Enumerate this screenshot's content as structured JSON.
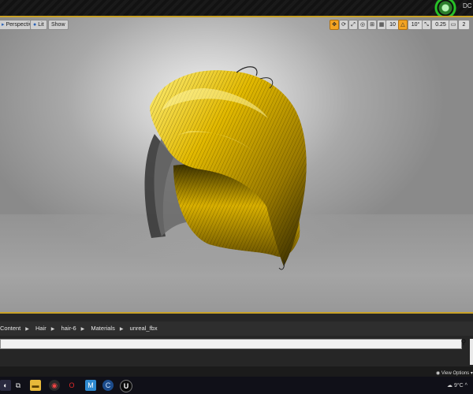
{
  "window": {
    "title": "DC"
  },
  "viewport": {
    "perspective_label": "Perspective",
    "lit_label": "Lit",
    "show_label": "Show",
    "grid_snap_value": "10",
    "rotation_snap_value": "10°",
    "scale_snap_value": "0.25",
    "camera_speed_value": "2"
  },
  "content_browser": {
    "path": [
      "Content",
      "Hair",
      "hair-6",
      "Materials",
      "unreal_fbx"
    ],
    "search_placeholder": "",
    "view_options_label": "View Options"
  },
  "taskbar": {
    "weather_temp": "9°C"
  },
  "colors": {
    "accent": "#c9a227",
    "hair": "#e0b800",
    "orange_active": "#f2a322"
  }
}
